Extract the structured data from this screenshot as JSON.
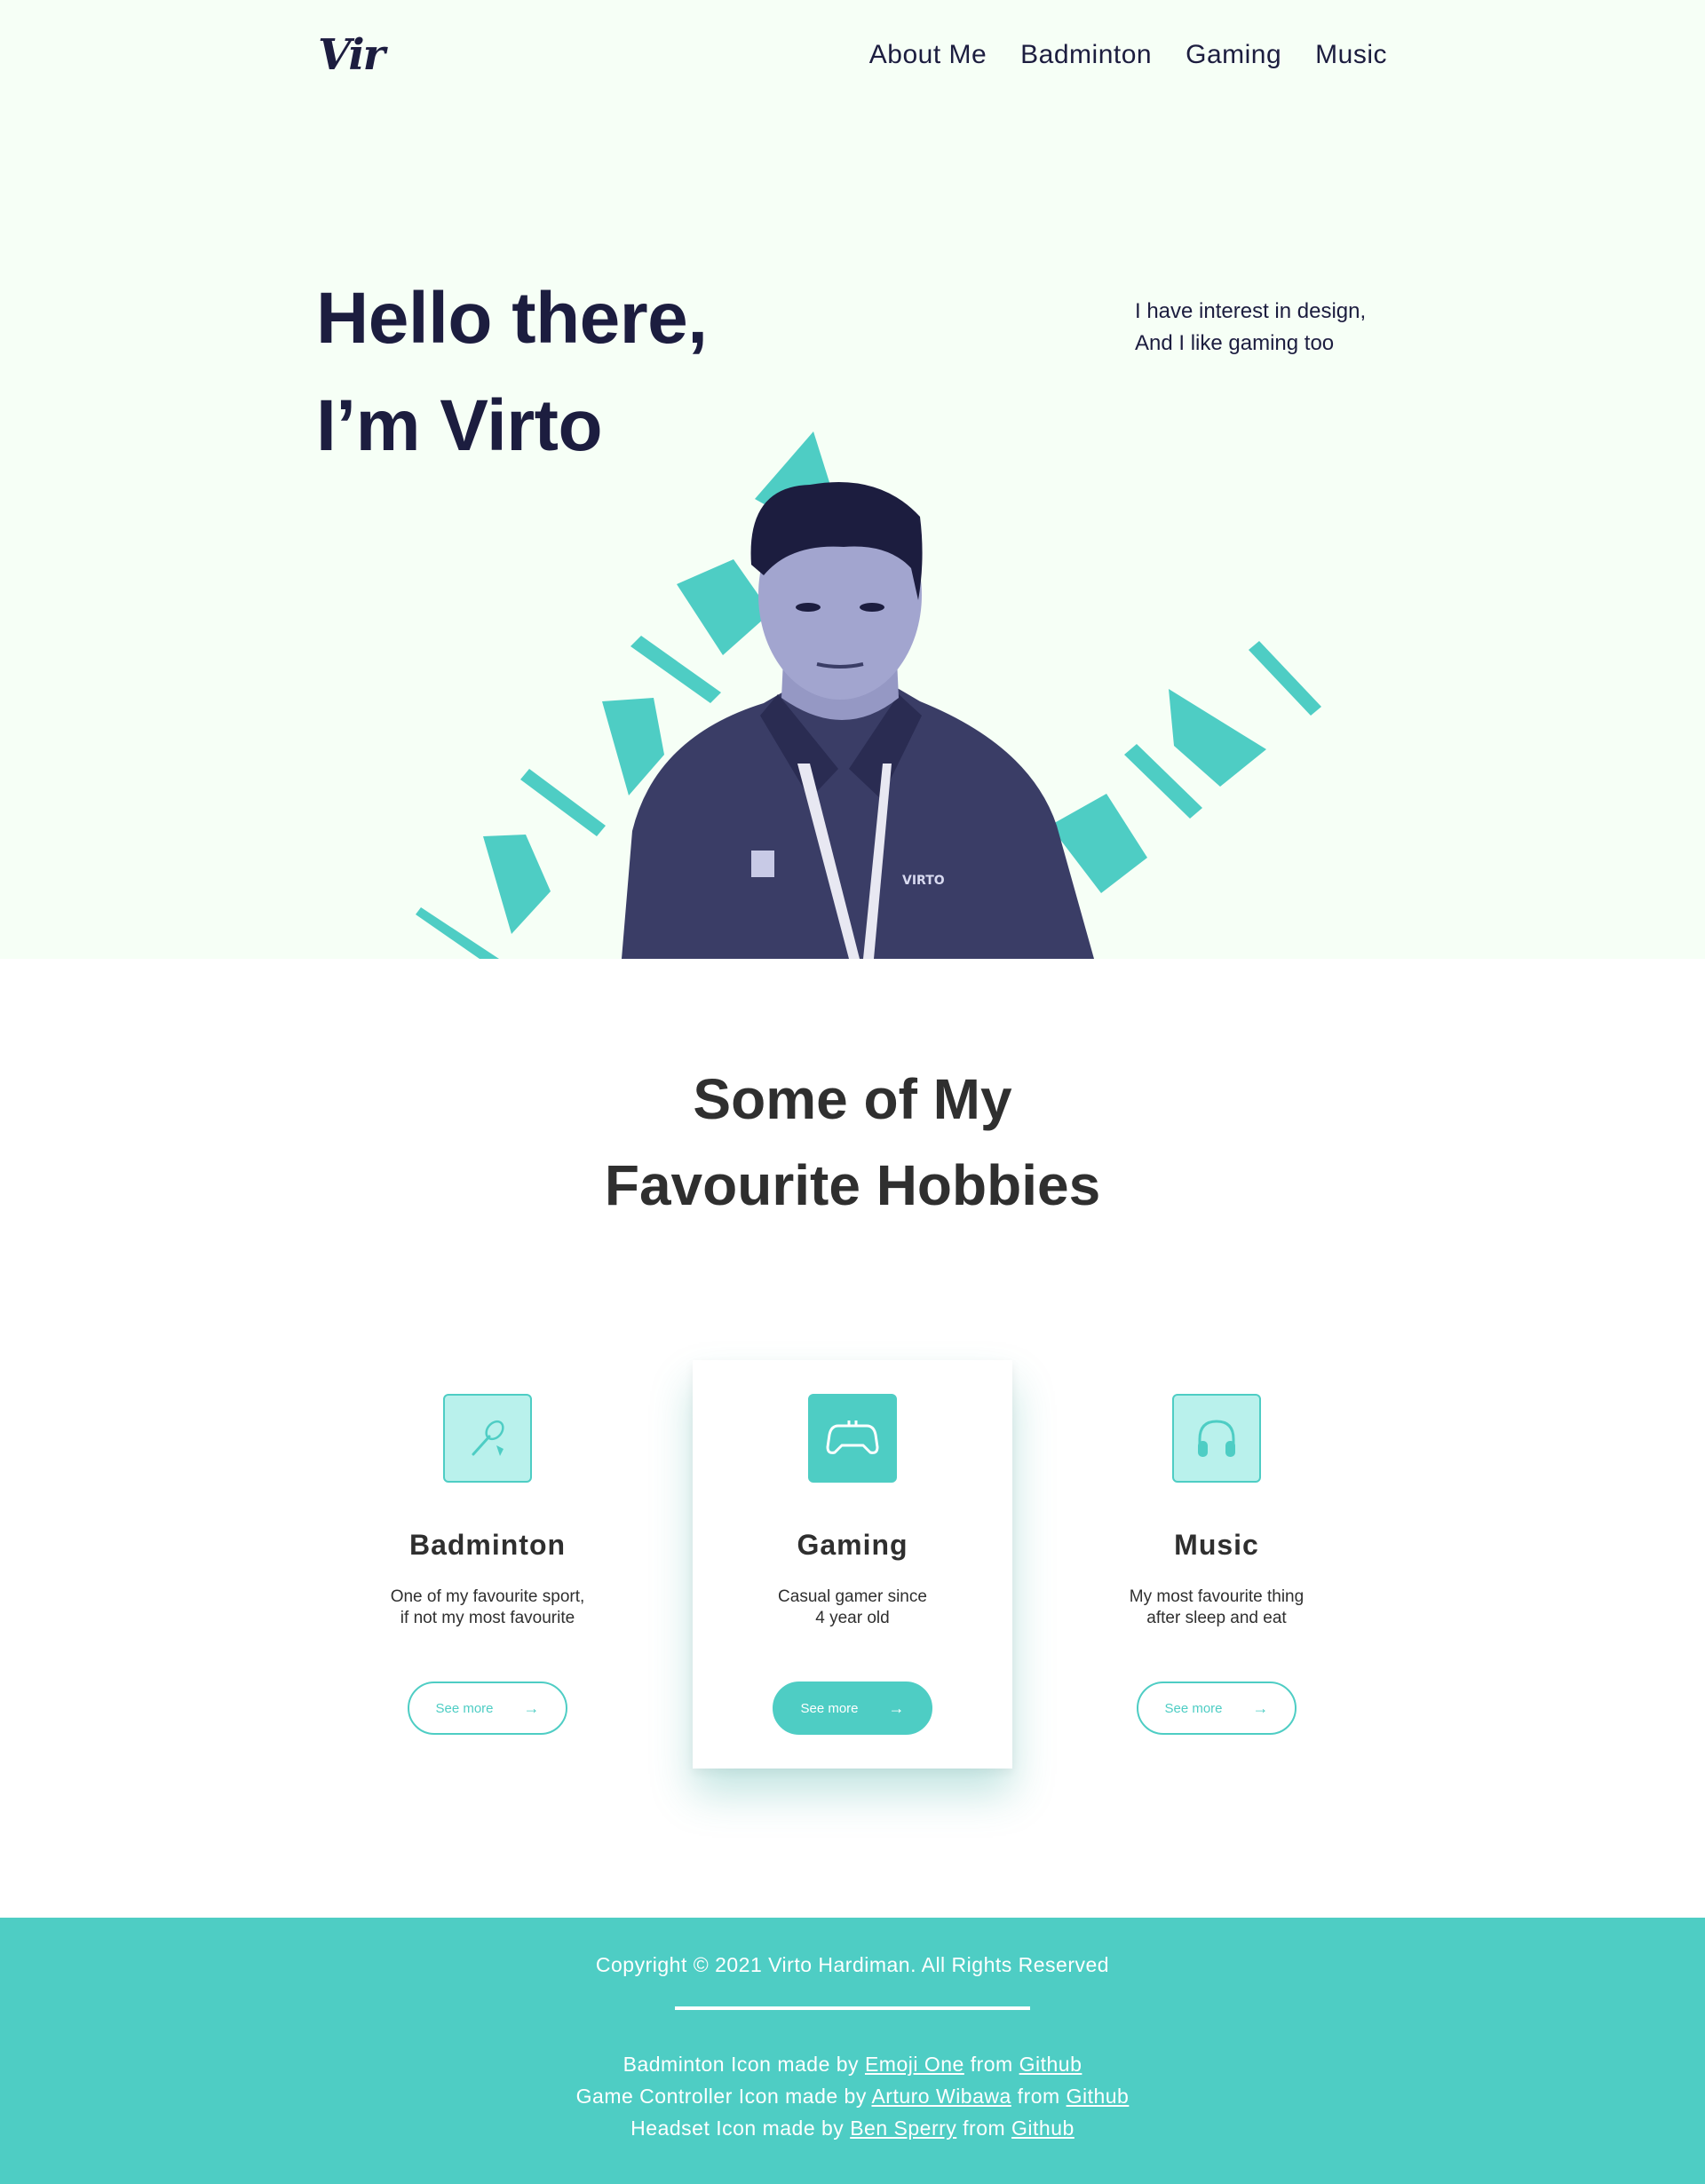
{
  "nav": {
    "logo": "Vir",
    "links": [
      "About Me",
      "Badminton",
      "Gaming",
      "Music"
    ]
  },
  "hero": {
    "title_line1": "Hello there,",
    "title_line2": "I’m Virto",
    "tagline_line1": "I have interest in design,",
    "tagline_line2": "And I like gaming too",
    "portrait_shirt_text": "VIRTO",
    "accent_color": "#4ecdc4",
    "portrait_tint": "#7a7db0"
  },
  "hobbies": {
    "title_line1": "Some of My",
    "title_line2": "Favourite Hobbies",
    "cards": [
      {
        "icon": "badminton-racket-icon",
        "title": "Badminton",
        "desc_line1": "One of my favourite sport,",
        "desc_line2": "if not my most favourite",
        "button": "See more",
        "active": false
      },
      {
        "icon": "game-controller-icon",
        "title": "Gaming",
        "desc_line1": "Casual gamer since",
        "desc_line2": "4 year old",
        "button": "See more",
        "active": true
      },
      {
        "icon": "headset-icon",
        "title": "Music",
        "desc_line1": "My most favourite thing",
        "desc_line2": "after sleep and eat",
        "button": "See more",
        "active": false
      }
    ]
  },
  "footer": {
    "copyright": "Copyright © 2021 Virto Hardiman. All Rights Reserved",
    "credits": [
      {
        "prefix": "Badminton Icon made by ",
        "author": "Emoji One",
        "mid": " from ",
        "source": "Github"
      },
      {
        "prefix": "Game Controller Icon made by ",
        "author": "Arturo Wibawa",
        "mid": " from ",
        "source": "Github"
      },
      {
        "prefix": "Headset Icon made by ",
        "author": "Ben Sperry",
        "mid": " from ",
        "source": "Github"
      }
    ],
    "background": "#4ecdc4"
  }
}
